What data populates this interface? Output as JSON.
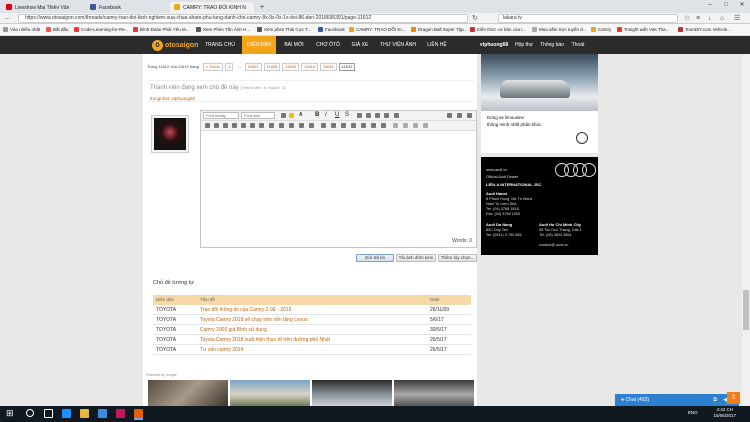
{
  "tabs": [
    {
      "label": "Liveshow Mai Thiên Vân",
      "color": "#d00"
    },
    {
      "label": "Facebook",
      "color": "#3b5998"
    },
    {
      "label": "CAMRY: TRAO ĐỔI KINH N",
      "color": "#f2a51a",
      "active": true
    }
  ],
  "browser": {
    "url": "https://www.otosaigon.com/threads/camry-trao-doi-kinh-nghiem-sua-chua-share-phu-tung-danh-cho-camry-8x-9x-0x-1x-doi-86-den-2018695391/page-11612",
    "search": "lakara tv"
  },
  "bookmarks": [
    "Vào nhiều nhất",
    "Bắt đầu",
    "Code-Learning-for-Re...",
    "Bình Đoàn Phải Yêu M...",
    "Xem Phim Tần Ánh H...",
    "Xem phim Thái Cực T...",
    "Facebook",
    "CAMRY: TRAO ĐỔI KI...",
    "Dragon Ball Super Tập...",
    "Kiến thức cơ bản của t...",
    "Mua sắm trực tuyến d...",
    "Camry",
    "Tonight with Viet Tha...",
    "ToonDIY.com Vehicle..."
  ],
  "site": {
    "logo": "otosaigon",
    "nav": [
      "TRANG CHỦ",
      "DIỄN ĐÀN",
      "BÀI MỚI",
      "CHỢ ÔTÔ",
      "GIÁ XE",
      "THƯ VIỆN ẢNH",
      "LIÊN HỆ"
    ],
    "active_nav": "DIỄN ĐÀN",
    "user": "vtphuong68",
    "user_links": [
      "Hộp thư",
      "Thông báo",
      "Thoát"
    ]
  },
  "pagination": {
    "label": "Trang 11612 của 11612 trang",
    "prev": "« Trước",
    "pages": [
      "1",
      "...",
      "11607",
      "11608",
      "11609",
      "11610",
      "11611",
      "11612"
    ],
    "current": "11612"
  },
  "viewers": {
    "title": "Thành viên đang xem chủ đề này",
    "detail": "(Thành viên: 6, Khách: 3)",
    "users": "trungnhat, vtphuong68"
  },
  "editor": {
    "font_family": "Font family",
    "font_size": "Font size",
    "word_count": "Words: 0"
  },
  "buttons": {
    "reply": "Gửi trả lời",
    "attach": "Tải ảnh đính kèm",
    "more": "Thêm tùy chọn..."
  },
  "similar": {
    "title": "Chủ đề tương tự",
    "headers": [
      "Diễn đàn",
      "Tiêu đề",
      "Date"
    ],
    "rows": [
      {
        "forum": "TOYOTA",
        "title": "Trao đổi thông tin của Camry 2.0E - 2016",
        "date": "26/11/09"
      },
      {
        "forum": "TOYOTA",
        "title": "Toyota Camry 2018 sẽ chạy trên nền tảng Lexus",
        "date": "5/6/17"
      },
      {
        "forum": "TOYOTA",
        "title": "Camry 2000 giá Bình sử dụng",
        "date": "30/5/17"
      },
      {
        "forum": "TOYOTA",
        "title": "Toyota Camry 2018 xuất hiện thực tế trên đường phố Nhật",
        "date": "26/5/17"
      },
      {
        "forum": "TOYOTA",
        "title": "Tư vấn camry 2014",
        "date": "26/5/17"
      }
    ]
  },
  "ads": {
    "google_label": "Powered by Google",
    "merc_line1": "Dòng xe limousine",
    "merc_line2": "thông minh nhất phân khúc.",
    "audi": {
      "tagline": "www.audi.vn",
      "dealer": "Official Audi Dealer",
      "company": "LIÊN-A INTERNATIONAL JSC",
      "hanoi": "Audi Hanoi",
      "hanoi_addr": "8 Pham Hung, Me Tri Ward",
      "hanoi_city": "Nam Tu Liem Dist.",
      "hanoi_tel": "Tel: (04) 3768 1818",
      "hanoi_fax": "Fax: (04) 3768 1900",
      "danang": "Audi Da Nang",
      "danang_addr": "85C Duy Tan",
      "danang_tel": "Tel: (0511) 3 790 666",
      "hcm": "Audi Ho Chi Minh City",
      "hcm_addr": "65 Ton Duc Thang, Dist 1",
      "hcm_tel": "Tel: (08) 3824 3861",
      "site": "contact@ audi.vn"
    }
  },
  "chat": {
    "label": "Chat",
    "count": "(493)"
  },
  "taskbar": {
    "lang": "ENG",
    "time": "4:42 CH",
    "date": "15/06/2017"
  }
}
